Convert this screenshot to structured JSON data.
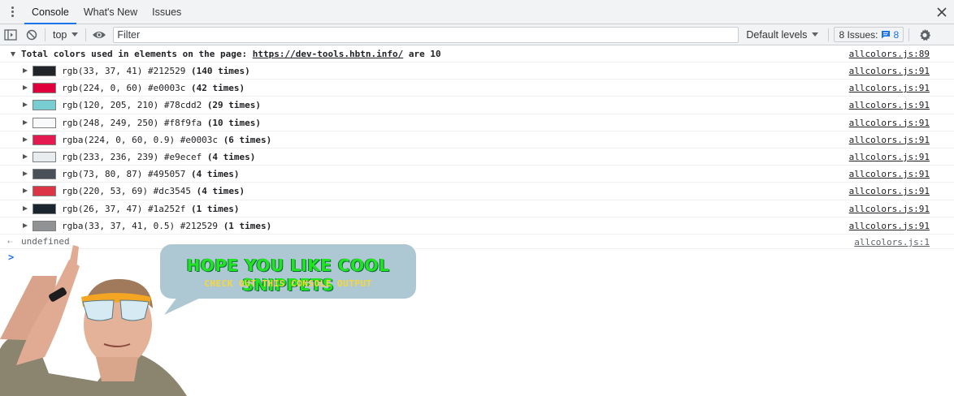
{
  "tabs": [
    {
      "label": "Console"
    },
    {
      "label": "What's New"
    },
    {
      "label": "Issues"
    }
  ],
  "toolbar": {
    "context": "top",
    "filter_placeholder": "Filter",
    "levels": "Default levels",
    "issues_label": "8 Issues:",
    "issues_count": "8"
  },
  "group": {
    "prefix": "Total colors used in elements on the page:",
    "url": "https://dev-tools.hbtn.info/",
    "suffix": "are 10",
    "source": "allcolors.js:89"
  },
  "rows": [
    {
      "color": "#212529",
      "text": "rgb(33, 37, 41) #212529",
      "count": "(140 times)",
      "source": "allcolors.js:91"
    },
    {
      "color": "#e0003c",
      "text": "rgb(224, 0, 60) #e0003c",
      "count": "(42 times)",
      "source": "allcolors.js:91"
    },
    {
      "color": "#78cdd2",
      "text": "rgb(120, 205, 210) #78cdd2",
      "count": "(29 times)",
      "source": "allcolors.js:91"
    },
    {
      "color": "#f8f9fa",
      "text": "rgb(248, 249, 250) #f8f9fa",
      "count": "(10 times)",
      "source": "allcolors.js:91"
    },
    {
      "color": "rgba(224, 0, 60, 0.9)",
      "text": "rgba(224, 0, 60, 0.9) #e0003c",
      "count": "(6 times)",
      "source": "allcolors.js:91"
    },
    {
      "color": "#e9ecef",
      "text": "rgb(233, 236, 239) #e9ecef",
      "count": "(4 times)",
      "source": "allcolors.js:91"
    },
    {
      "color": "#495057",
      "text": "rgb(73, 80, 87) #495057",
      "count": "(4 times)",
      "source": "allcolors.js:91"
    },
    {
      "color": "#dc3545",
      "text": "rgb(220, 53, 69) #dc3545",
      "count": "(4 times)",
      "source": "allcolors.js:91"
    },
    {
      "color": "#1a252f",
      "text": "rgb(26, 37, 47) #1a252f",
      "count": "(1 times)",
      "source": "allcolors.js:91"
    },
    {
      "color": "rgba(33, 37, 41, 0.5)",
      "text": "rgba(33, 37, 41, 0.5) #212529",
      "count": "(1 times)",
      "source": "allcolors.js:91"
    }
  ],
  "result": {
    "text": "undefined",
    "source": "allcolors.js:1"
  },
  "meme": {
    "title": "HOPE YOU LIKE COOL SNIPPETS",
    "subtitle": "CHECK OUT THIS CONSOLE OUTPUT"
  },
  "icons": [
    "kebab-menu-icon",
    "close-icon",
    "sidebar-toggle-icon",
    "clear-console-icon",
    "eye-icon",
    "message-icon",
    "gear-icon"
  ]
}
